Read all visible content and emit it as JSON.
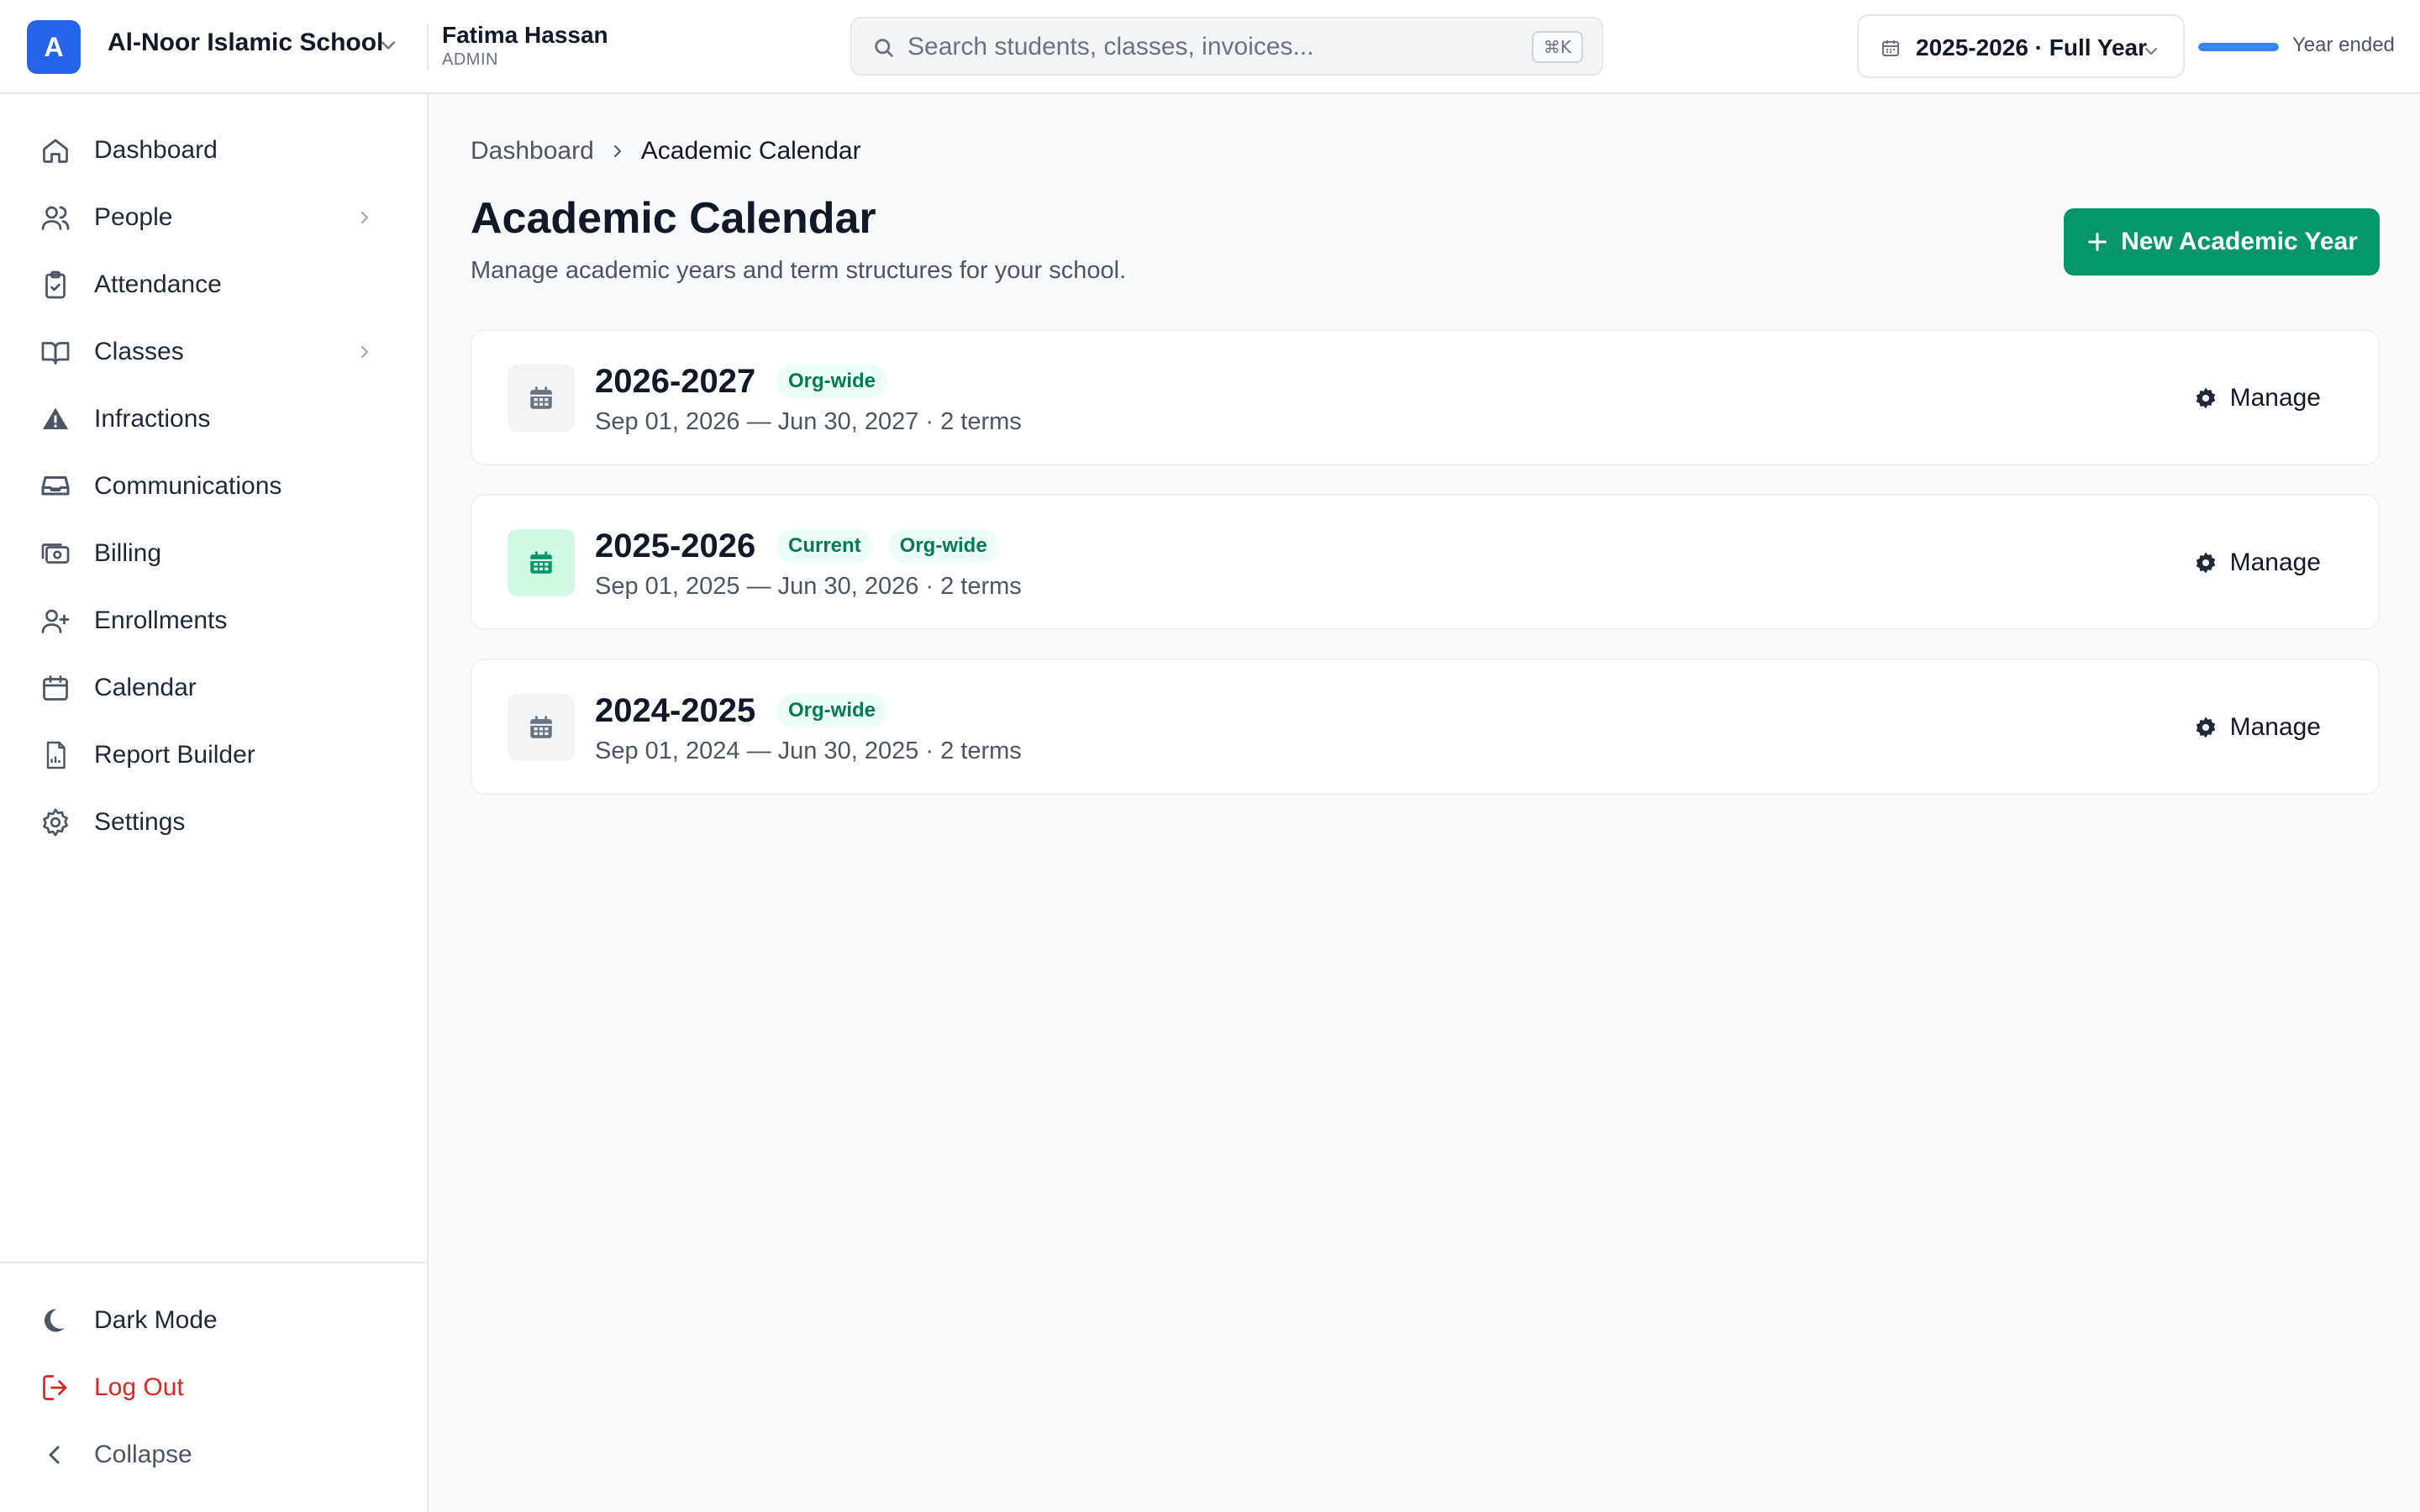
{
  "header": {
    "org_initial": "A",
    "org_name": "Al-Noor Islamic School",
    "user_name": "Fatima Hassan",
    "user_role": "ADMIN",
    "search_placeholder": "Search students, classes, invoices...",
    "search_shortcut": "⌘K",
    "year_selector": "2025-2026 · Full Year",
    "year_progress_percent": 100,
    "year_status": "Year ended"
  },
  "sidebar": {
    "items": [
      {
        "label": "Dashboard",
        "icon": "home-icon"
      },
      {
        "label": "People",
        "icon": "users-icon",
        "expandable": true
      },
      {
        "label": "Attendance",
        "icon": "clipboard-check-icon"
      },
      {
        "label": "Classes",
        "icon": "book-icon",
        "expandable": true
      },
      {
        "label": "Infractions",
        "icon": "warning-icon"
      },
      {
        "label": "Communications",
        "icon": "inbox-icon"
      },
      {
        "label": "Billing",
        "icon": "money-icon"
      },
      {
        "label": "Enrollments",
        "icon": "user-plus-icon"
      },
      {
        "label": "Calendar",
        "icon": "calendar-icon"
      },
      {
        "label": "Report Builder",
        "icon": "report-icon"
      },
      {
        "label": "Settings",
        "icon": "gear-icon"
      }
    ],
    "footer": {
      "dark_mode": "Dark Mode",
      "logout": "Log Out",
      "collapse": "Collapse"
    }
  },
  "breadcrumb": {
    "parent": "Dashboard",
    "current": "Academic Calendar"
  },
  "page": {
    "title": "Academic Calendar",
    "subtitle": "Manage academic years and term structures for your school.",
    "new_button": "New Academic Year"
  },
  "years": [
    {
      "name": "2026-2027",
      "badges": [
        "Org-wide"
      ],
      "meta": "Sep 01, 2026 — Jun 30, 2027 · 2 terms",
      "current": false,
      "action": "Manage"
    },
    {
      "name": "2025-2026",
      "badges": [
        "Current",
        "Org-wide"
      ],
      "meta": "Sep 01, 2025 — Jun 30, 2026 · 2 terms",
      "current": true,
      "action": "Manage"
    },
    {
      "name": "2024-2025",
      "badges": [
        "Org-wide"
      ],
      "meta": "Sep 01, 2024 — Jun 30, 2025 · 2 terms",
      "current": false,
      "action": "Manage"
    }
  ],
  "colors": {
    "brand_blue": "#2563eb",
    "primary_green": "#059669",
    "badge_bg": "#ecfdf5",
    "badge_text": "#047857",
    "danger": "#dc2626"
  }
}
